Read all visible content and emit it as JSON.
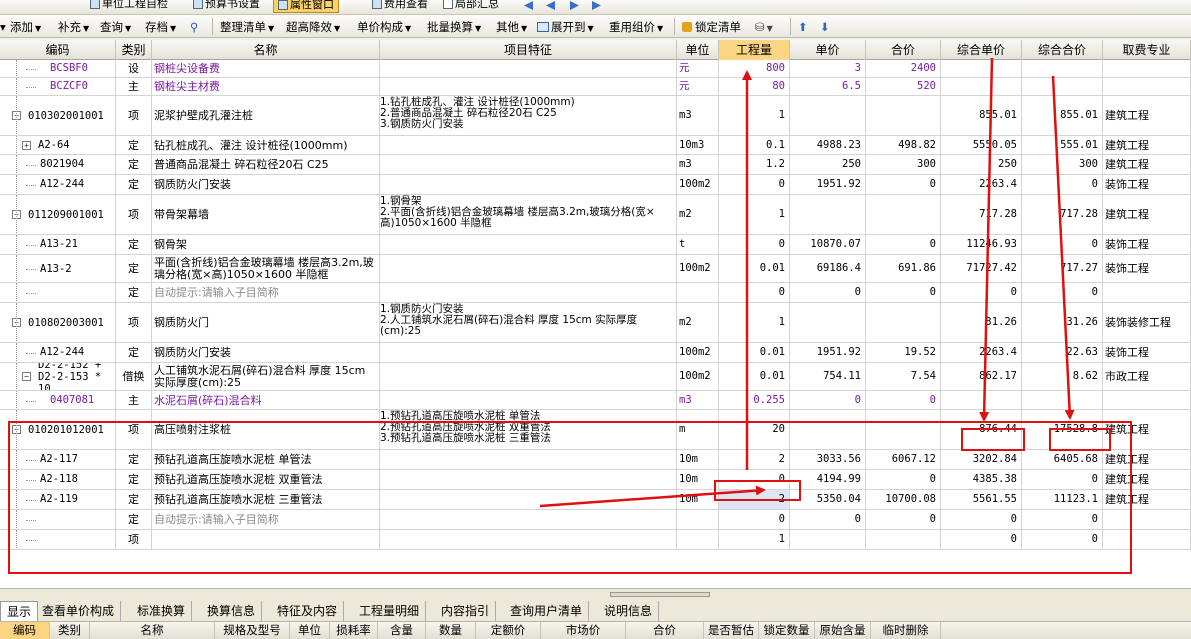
{
  "toolbar_top": {
    "items": [
      "单位工程自检",
      "预算书设置",
      "属性窗口",
      "费用查看",
      "局部汇总"
    ]
  },
  "toolbar_main": {
    "items": [
      {
        "label": "添加",
        "dropdown": true
      },
      {
        "label": "补充",
        "dropdown": true
      },
      {
        "label": "查询",
        "dropdown": true
      },
      {
        "label": "存档",
        "dropdown": true
      },
      {
        "label": "整理清单",
        "dropdown": true
      },
      {
        "label": "超高降效",
        "dropdown": true
      },
      {
        "label": "单价构成",
        "dropdown": true
      },
      {
        "label": "批量换算",
        "dropdown": true
      },
      {
        "label": "其他",
        "dropdown": true
      },
      {
        "label": "展开到",
        "dropdown": true
      },
      {
        "label": "重用组价",
        "dropdown": true
      },
      {
        "label": "锁定清单",
        "dropdown": false
      }
    ]
  },
  "grid": {
    "headers": [
      "编码",
      "类别",
      "名称",
      "项目特征",
      "单位",
      "工程量",
      "单价",
      "合价",
      "综合单价",
      "综合合价",
      "取费专业"
    ],
    "rows": [
      {
        "code": "BCSBF0",
        "type": "设",
        "name": "钢桩尖设备费",
        "feature": "",
        "unit": "元",
        "qty": "800",
        "price": "3",
        "total": "2400",
        "cprice": "",
        "ctotal": "",
        "spec": "",
        "purple": true
      },
      {
        "code": "BCZCF0",
        "type": "主",
        "name": "钢桩尖主材费",
        "feature": "",
        "unit": "元",
        "qty": "80",
        "price": "6.5",
        "total": "520",
        "cprice": "",
        "ctotal": "",
        "spec": "",
        "purple": true
      },
      {
        "code": "010302001001",
        "type": "项",
        "name": "泥浆护壁成孔灌注桩",
        "feature": "1.钻孔桩成孔、灌注 设计桩径(1000mm)\n2.普通商品混凝土 碎石粒径20石 C25\n3.钢质防火门安装",
        "unit": "m3",
        "qty": "1",
        "price": "",
        "total": "",
        "cprice": "855.01",
        "ctotal": "855.01",
        "spec": "建筑工程",
        "expand": "minus"
      },
      {
        "code": "A2-64",
        "type": "定",
        "name": "钻孔桩成孔、灌注 设计桩径(1000mm)",
        "feature": "",
        "unit": "10m3",
        "qty": "0.1",
        "price": "4988.23",
        "total": "498.82",
        "cprice": "5550.05",
        "ctotal": "555.01",
        "spec": "建筑工程",
        "expand": "plus"
      },
      {
        "code": "8021904",
        "type": "定",
        "name": "普通商品混凝土 碎石粒径20石 C25",
        "feature": "",
        "unit": "m3",
        "qty": "1.2",
        "price": "250",
        "total": "300",
        "cprice": "250",
        "ctotal": "300",
        "spec": "建筑工程"
      },
      {
        "code": "A12-244",
        "type": "定",
        "name": "钢质防火门安装",
        "feature": "",
        "unit": "100m2",
        "qty": "0",
        "price": "1951.92",
        "total": "0",
        "cprice": "2263.4",
        "ctotal": "0",
        "spec": "装饰工程"
      },
      {
        "code": "011209001001",
        "type": "项",
        "name": "带骨架幕墙",
        "feature": "1.钢骨架\n2.平面(含折线)铝合金玻璃幕墙 楼层高3.2m,玻璃分格(宽×高)1050×1600 半隐框",
        "unit": "m2",
        "qty": "1",
        "price": "",
        "total": "",
        "cprice": "717.28",
        "ctotal": "717.28",
        "spec": "建筑工程",
        "expand": "minus"
      },
      {
        "code": "A13-21",
        "type": "定",
        "name": "钢骨架",
        "feature": "",
        "unit": "t",
        "qty": "0",
        "price": "10870.07",
        "total": "0",
        "cprice": "11246.93",
        "ctotal": "0",
        "spec": "装饰工程"
      },
      {
        "code": "A13-2",
        "type": "定",
        "name": "平面(含折线)铝合金玻璃幕墙 楼层高3.2m,玻璃分格(宽×高)1050×1600 半隐框",
        "feature": "",
        "unit": "100m2",
        "qty": "0.01",
        "price": "69186.4",
        "total": "691.86",
        "cprice": "71727.42",
        "ctotal": "717.27",
        "spec": "装饰工程"
      },
      {
        "code": "",
        "type": "定",
        "name": "自动提示:请输入子目简称",
        "feature": "",
        "unit": "",
        "qty": "0",
        "price": "0",
        "total": "0",
        "cprice": "0",
        "ctotal": "0",
        "spec": "",
        "grey": true
      },
      {
        "code": "010802003001",
        "type": "项",
        "name": "钢质防火门",
        "feature": "1.钢质防火门安装\n2.人工铺筑水泥石屑(碎石)混合料 厚度 15cm 实际厚度(cm):25",
        "unit": "m2",
        "qty": "1",
        "price": "",
        "total": "",
        "cprice": "31.26",
        "ctotal": "31.26",
        "spec": "装饰装修工程",
        "expand": "minus"
      },
      {
        "code": "A12-244",
        "type": "定",
        "name": "钢质防火门安装",
        "feature": "",
        "unit": "100m2",
        "qty": "0.01",
        "price": "1951.92",
        "total": "19.52",
        "cprice": "2263.4",
        "ctotal": "22.63",
        "spec": "装饰工程"
      },
      {
        "code": "D2-2-152 + D2-2-153 * 10",
        "type": "借换",
        "name": "人工铺筑水泥石屑(碎石)混合料 厚度 15cm 实际厚度(cm):25",
        "feature": "",
        "unit": "100m2",
        "qty": "0.01",
        "price": "754.11",
        "total": "7.54",
        "cprice": "862.17",
        "ctotal": "8.62",
        "spec": "市政工程",
        "expand": "minus"
      },
      {
        "code": "0407081",
        "type": "主",
        "name": "水泥石屑(碎石)混合料",
        "feature": "",
        "unit": "m3",
        "qty": "0.255",
        "price": "0",
        "total": "0",
        "cprice": "",
        "ctotal": "",
        "spec": "",
        "purple": true
      },
      {
        "code": "010201012001",
        "type": "项",
        "name": "高压喷射注浆桩",
        "feature": "1.预钻孔道高压旋喷水泥桩 单管法\n2.预钻孔道高压旋喷水泥桩 双重管法\n3.预钻孔道高压旋喷水泥桩 三重管法",
        "unit": "m",
        "qty": "20",
        "price": "",
        "total": "",
        "cprice": "876.44",
        "ctotal": "17528.8",
        "spec": "建筑工程",
        "expand": "minus"
      },
      {
        "code": "A2-117",
        "type": "定",
        "name": "预钻孔道高压旋喷水泥桩 单管法",
        "feature": "",
        "unit": "10m",
        "qty": "2",
        "price": "3033.56",
        "total": "6067.12",
        "cprice": "3202.84",
        "ctotal": "6405.68",
        "spec": "建筑工程"
      },
      {
        "code": "A2-118",
        "type": "定",
        "name": "预钻孔道高压旋喷水泥桩 双重管法",
        "feature": "",
        "unit": "10m",
        "qty": "0",
        "price": "4194.99",
        "total": "0",
        "cprice": "4385.38",
        "ctotal": "0",
        "spec": "建筑工程"
      },
      {
        "code": "A2-119",
        "type": "定",
        "name": "预钻孔道高压旋喷水泥桩 三重管法",
        "feature": "",
        "unit": "10m",
        "qty": "2",
        "price": "5350.04",
        "total": "10700.08",
        "cprice": "5561.55",
        "ctotal": "11123.1",
        "spec": "建筑工程",
        "selected": true
      },
      {
        "code": "",
        "type": "定",
        "name": "自动提示:请输入子目简称",
        "feature": "",
        "unit": "",
        "qty": "0",
        "price": "0",
        "total": "0",
        "cprice": "0",
        "ctotal": "0",
        "spec": "",
        "grey": true
      },
      {
        "code": "",
        "type": "项",
        "name": "",
        "feature": "",
        "unit": "",
        "qty": "1",
        "price": "",
        "total": "",
        "cprice": "0",
        "ctotal": "0",
        "spec": ""
      }
    ]
  },
  "bottom_tabs": [
    "显示",
    "查看单价构成",
    "标准换算",
    "换算信息",
    "特征及内容",
    "工程量明细",
    "内容指引",
    "查询用户清单",
    "说明信息"
  ],
  "sub_headers": [
    "编码",
    "类别",
    "名称",
    "规格及型号",
    "单位",
    "损耗率",
    "含量",
    "数量",
    "定额价",
    "市场价",
    "合价",
    "是否暂估",
    "锁定数量",
    "原始含量",
    "临时删除"
  ],
  "colors": {
    "annotation": "#e01010",
    "header_highlight": "#fbd682",
    "purple_text": "#7a1aa0"
  }
}
